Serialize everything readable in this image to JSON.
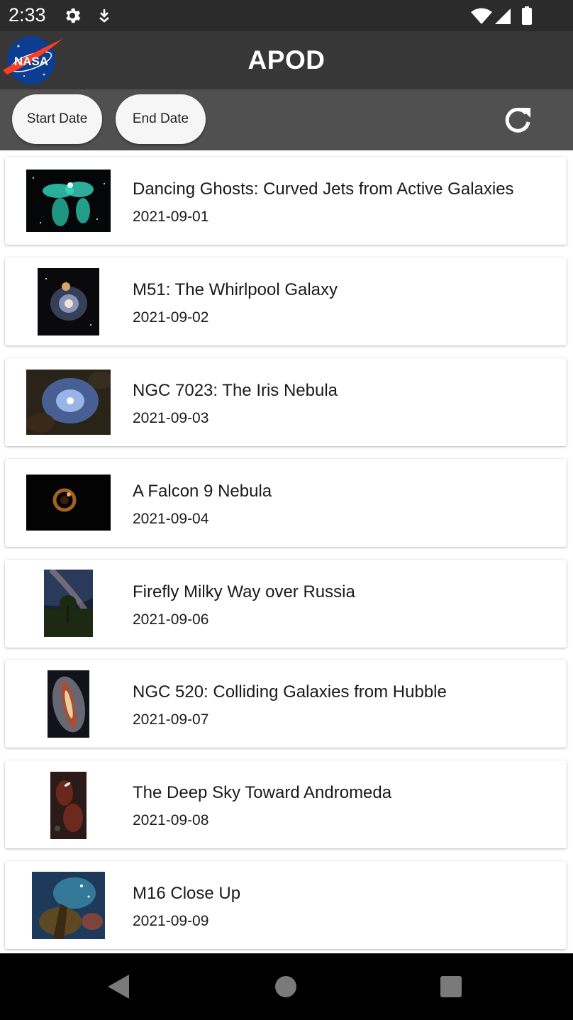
{
  "status_bar": {
    "time": "2:33",
    "icons": [
      "gear-icon",
      "download-icon",
      "wifi-icon",
      "signal-icon",
      "battery-icon"
    ]
  },
  "app_bar": {
    "logo_text": "NASA",
    "title": "APOD"
  },
  "toolbar": {
    "start_date_label": "Start Date",
    "end_date_label": "End Date",
    "refresh_icon": "refresh-icon"
  },
  "items": [
    {
      "title": "Dancing Ghosts: Curved Jets from Active Galaxies",
      "date": "2021-09-01"
    },
    {
      "title": "M51: The Whirlpool Galaxy",
      "date": "2021-09-02"
    },
    {
      "title": "NGC 7023: The Iris Nebula",
      "date": "2021-09-03"
    },
    {
      "title": "A Falcon 9 Nebula",
      "date": "2021-09-04"
    },
    {
      "title": "Firefly Milky Way over Russia",
      "date": "2021-09-06"
    },
    {
      "title": "NGC 520: Colliding Galaxies from Hubble",
      "date": "2021-09-07"
    },
    {
      "title": "The Deep Sky Toward Andromeda",
      "date": "2021-09-08"
    },
    {
      "title": "M16 Close Up",
      "date": "2021-09-09"
    }
  ],
  "nav_bar": {
    "icons": [
      "back-icon",
      "home-icon",
      "recents-icon"
    ]
  },
  "colors": {
    "status_bar": "#2b2b2b",
    "app_bar": "#373737",
    "toolbar": "#505050",
    "pill": "#f6f6f6"
  }
}
